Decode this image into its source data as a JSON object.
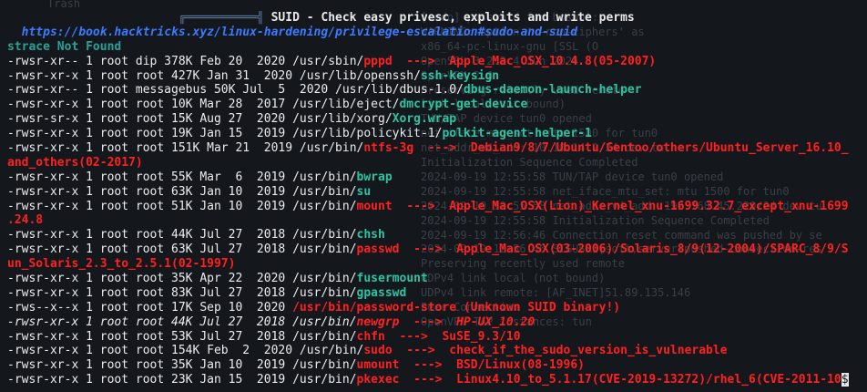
{
  "header": {
    "trash_label": "Trash",
    "title": "SUID - Check easy privesc, exploits and write perms",
    "link": "https://book.hacktricks.xyz/linux-hardening/privilege-escalation#sudo-and-suid",
    "strace_msg": "strace Not Found"
  },
  "background_text": [
    "[sudo] password for bosant:",
    "WARNING: option '--ncp-ciphers' as",
    "x86_64-pc-linux-gnu [SSL (O",
    "OpenSSL 3.2.2 4 Jun 2024",
    "OpenVPN 2.6",
    "Preserving recently used remote",
    "link local (not bound)",
    "TUN/TAP device tun0 opened",
    "net_iface_mtu_set: mtu 1500 for tun0",
    "net_addr_v4_add: 10.10.14.2/24 dev tu",
    "Initialization Sequence Completed",
    "2024-09-19 12:55:58 TUN/TAP device tun0 opened",
    "2024-09-19 12:55:58 net_iface_mtu_set: mtu 1500 for tun0",
    "2024-09-19 12:55:58 net_addr_v4_add: 192.168.45.220/24 dev tu",
    "2024-09-19 12:55:58 Initialization Sequence Completed",
    "2024-09-19 12:56:46 Connection reset command was pushed by se",
    "2024-09-19 12:56:46 SIGUSR1[soft,server-pushed-connection-res",
    "Preserving recently used remote",
    "UDPv4 link local (not bound)",
    "UDPv4 link remote: [AF_INET]51.89.135.146",
    "Peer Connection",
    "OpenVPN TAP instances: tun"
  ],
  "rows": [
    {
      "perm": "-rwsr-xr-- 1 root dip 378K Feb 20  2020 ",
      "dir": "/usr/sbin/",
      "bin": "pppd",
      "bin_color": "red",
      "note": "  --->  Apple_Mac_OSX_10.4.8(05-2007)",
      "wrap": ""
    },
    {
      "perm": "-rwsr-xr-x 1 root root 427K Jan 31  2020 ",
      "dir": "/usr/lib/openssh/",
      "bin": "ssh-keysign",
      "bin_color": "green",
      "note": "",
      "wrap": ""
    },
    {
      "perm": "-rwsr-xr-- 1 root messagebus 50K Jul  5  2020 ",
      "dir": "/usr/lib/dbus-1.0/",
      "bin": "dbus-daemon-launch-helper",
      "bin_color": "green",
      "note": "",
      "wrap": ""
    },
    {
      "perm": "-rwsr-xr-x 1 root root 10K Mar 28  2017 ",
      "dir": "/usr/lib/eject/",
      "bin": "dmcrypt-get-device",
      "bin_color": "green",
      "note": "",
      "wrap": ""
    },
    {
      "perm": "-rwsr-sr-x 1 root root 15K Aug 27  2020 ",
      "dir": "/usr/lib/xorg/",
      "bin": "Xorg.wrap",
      "bin_color": "green",
      "note": "",
      "wrap": ""
    },
    {
      "perm": "-rwsr-xr-x 1 root root 19K Jan 15  2019 ",
      "dir": "/usr/lib/policykit-1/",
      "bin": "polkit-agent-helper-1",
      "bin_color": "green",
      "note": "",
      "wrap": ""
    },
    {
      "perm": "-rwsr-xr-x 1 root root 151K Mar 21  2019 ",
      "dir": "/usr/bin/",
      "bin": "ntfs-3g",
      "bin_color": "red",
      "note": "  --->  Debian9/8/7/Ubuntu/Gentoo/others/Ubuntu_Server_16.10_",
      "wrap": "and_others(02-2017)"
    },
    {
      "perm": "-rwsr-xr-x 1 root root 55K Mar  6  2019 ",
      "dir": "/usr/bin/",
      "bin": "bwrap",
      "bin_color": "green",
      "note": "",
      "wrap": ""
    },
    {
      "perm": "-rwsr-xr-x 1 root root 63K Jan 10  2019 ",
      "dir": "/usr/bin/",
      "bin": "su",
      "bin_color": "green",
      "note": "",
      "wrap": ""
    },
    {
      "perm": "-rwsr-xr-x 1 root root 51K Jan 10  2019 ",
      "dir": "/usr/bin/",
      "bin": "mount",
      "bin_color": "red",
      "note": "  --->  Apple_Mac_OSX(Lion)_Kernel_xnu-1699.32.7_except_xnu-1699",
      "wrap": ".24.8"
    },
    {
      "perm": "-rwsr-xr-x 1 root root 44K Jul 27  2018 ",
      "dir": "/usr/bin/",
      "bin": "chsh",
      "bin_color": "green",
      "note": "",
      "wrap": ""
    },
    {
      "perm": "-rwsr-xr-x 1 root root 63K Jul 27  2018 ",
      "dir": "/usr/bin/",
      "bin": "passwd",
      "bin_color": "red",
      "note": "  --->  Apple_Mac_OSX(03-2006)/Solaris_8/9(12-2004)/SPARC_8/9/S",
      "wrap": "un_Solaris_2.3_to_2.5.1(02-1997)"
    },
    {
      "perm": "-rwsr-xr-x 1 root root 35K Apr 22  2020 ",
      "dir": "/usr/bin/",
      "bin": "fusermount",
      "bin_color": "green",
      "note": "",
      "wrap": ""
    },
    {
      "perm": "-rwsr-xr-x 1 root root 83K Jul 27  2018 ",
      "dir": "/usr/bin/",
      "bin": "gpasswd",
      "bin_color": "green",
      "note": "",
      "wrap": ""
    },
    {
      "perm": "-rws--x--x 1 root root 17K Sep 10  2020 ",
      "dir": "/usr/bin/",
      "bin": "password-store (Unknown SUID binary!)",
      "bin_color": "red",
      "note": "",
      "wrap": "",
      "dir_red": true
    },
    {
      "perm": "-rwsr-xr-x 1 root root 44K Jul 27  2018 ",
      "dir": "/usr/bin/",
      "bin": "newgrp",
      "bin_color": "red",
      "note": "  --->  HP-UX_10.20",
      "wrap": "",
      "italic": true
    },
    {
      "perm": "-rwsr-xr-x 1 root root 53K Jul 27  2018 ",
      "dir": "/usr/bin/",
      "bin": "chfn",
      "bin_color": "red",
      "note": "  --->  SuSE_9.3/10",
      "wrap": ""
    },
    {
      "perm": "-rwsr-xr-x 1 root root 154K Feb  2  2020 ",
      "dir": "/usr/bin/",
      "bin": "sudo",
      "bin_color": "red",
      "note": "  --->  check_if_the_sudo_version_is_vulnerable",
      "wrap": ""
    },
    {
      "perm": "-rwsr-xr-x 1 root root 35K Jan 10  2019 ",
      "dir": "/usr/bin/",
      "bin": "umount",
      "bin_color": "red",
      "note": "  --->  BSD/Linux(08-1996)",
      "wrap": ""
    },
    {
      "perm": "-rwsr-xr-x 1 root root 23K Jan 15  2019 ",
      "dir": "/usr/bin/",
      "bin": "pkexec",
      "bin_color": "red",
      "note": "  --->  Linux4.10_to_5.1.17(CVE-2019-13272)/rhel_6(CVE-2011-10",
      "wrap": "",
      "cursor": "$"
    }
  ]
}
